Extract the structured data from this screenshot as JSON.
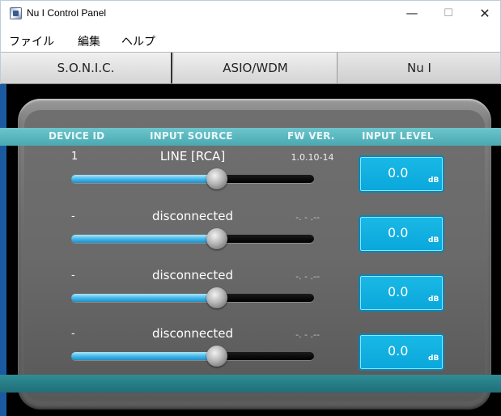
{
  "window": {
    "title": "Nu I Control Panel"
  },
  "window_controls": {
    "minimize": "—",
    "maximize": "☐",
    "close": "✕"
  },
  "menu": [
    "ファイル",
    "編集",
    "ヘルプ"
  ],
  "tabs": [
    "S.O.N.I.C.",
    "ASIO/WDM",
    "Nu I"
  ],
  "table": {
    "headers": {
      "device_id": "DEVICE ID",
      "input_source": "INPUT SOURCE",
      "fw_ver": "FW VER.",
      "input_level": "INPUT LEVEL"
    },
    "rows": [
      {
        "device_id": "1",
        "source": "LINE [RCA]",
        "fw": "1.0.10-14",
        "level": "0.0",
        "unit": "dB",
        "slider_percent": 60
      },
      {
        "device_id": "-",
        "source": "disconnected",
        "fw": "-. - .--",
        "level": "0.0",
        "unit": "dB",
        "slider_percent": 60
      },
      {
        "device_id": "-",
        "source": "disconnected",
        "fw": "-. - .--",
        "level": "0.0",
        "unit": "dB",
        "slider_percent": 60
      },
      {
        "device_id": "-",
        "source": "disconnected",
        "fw": "-. - .--",
        "level": "0.0",
        "unit": "dB",
        "slider_percent": 60
      }
    ]
  },
  "colors": {
    "accent": "#4aa9b1",
    "level_box": "#0aa7db",
    "slider_fill": "#3fb6ea"
  }
}
